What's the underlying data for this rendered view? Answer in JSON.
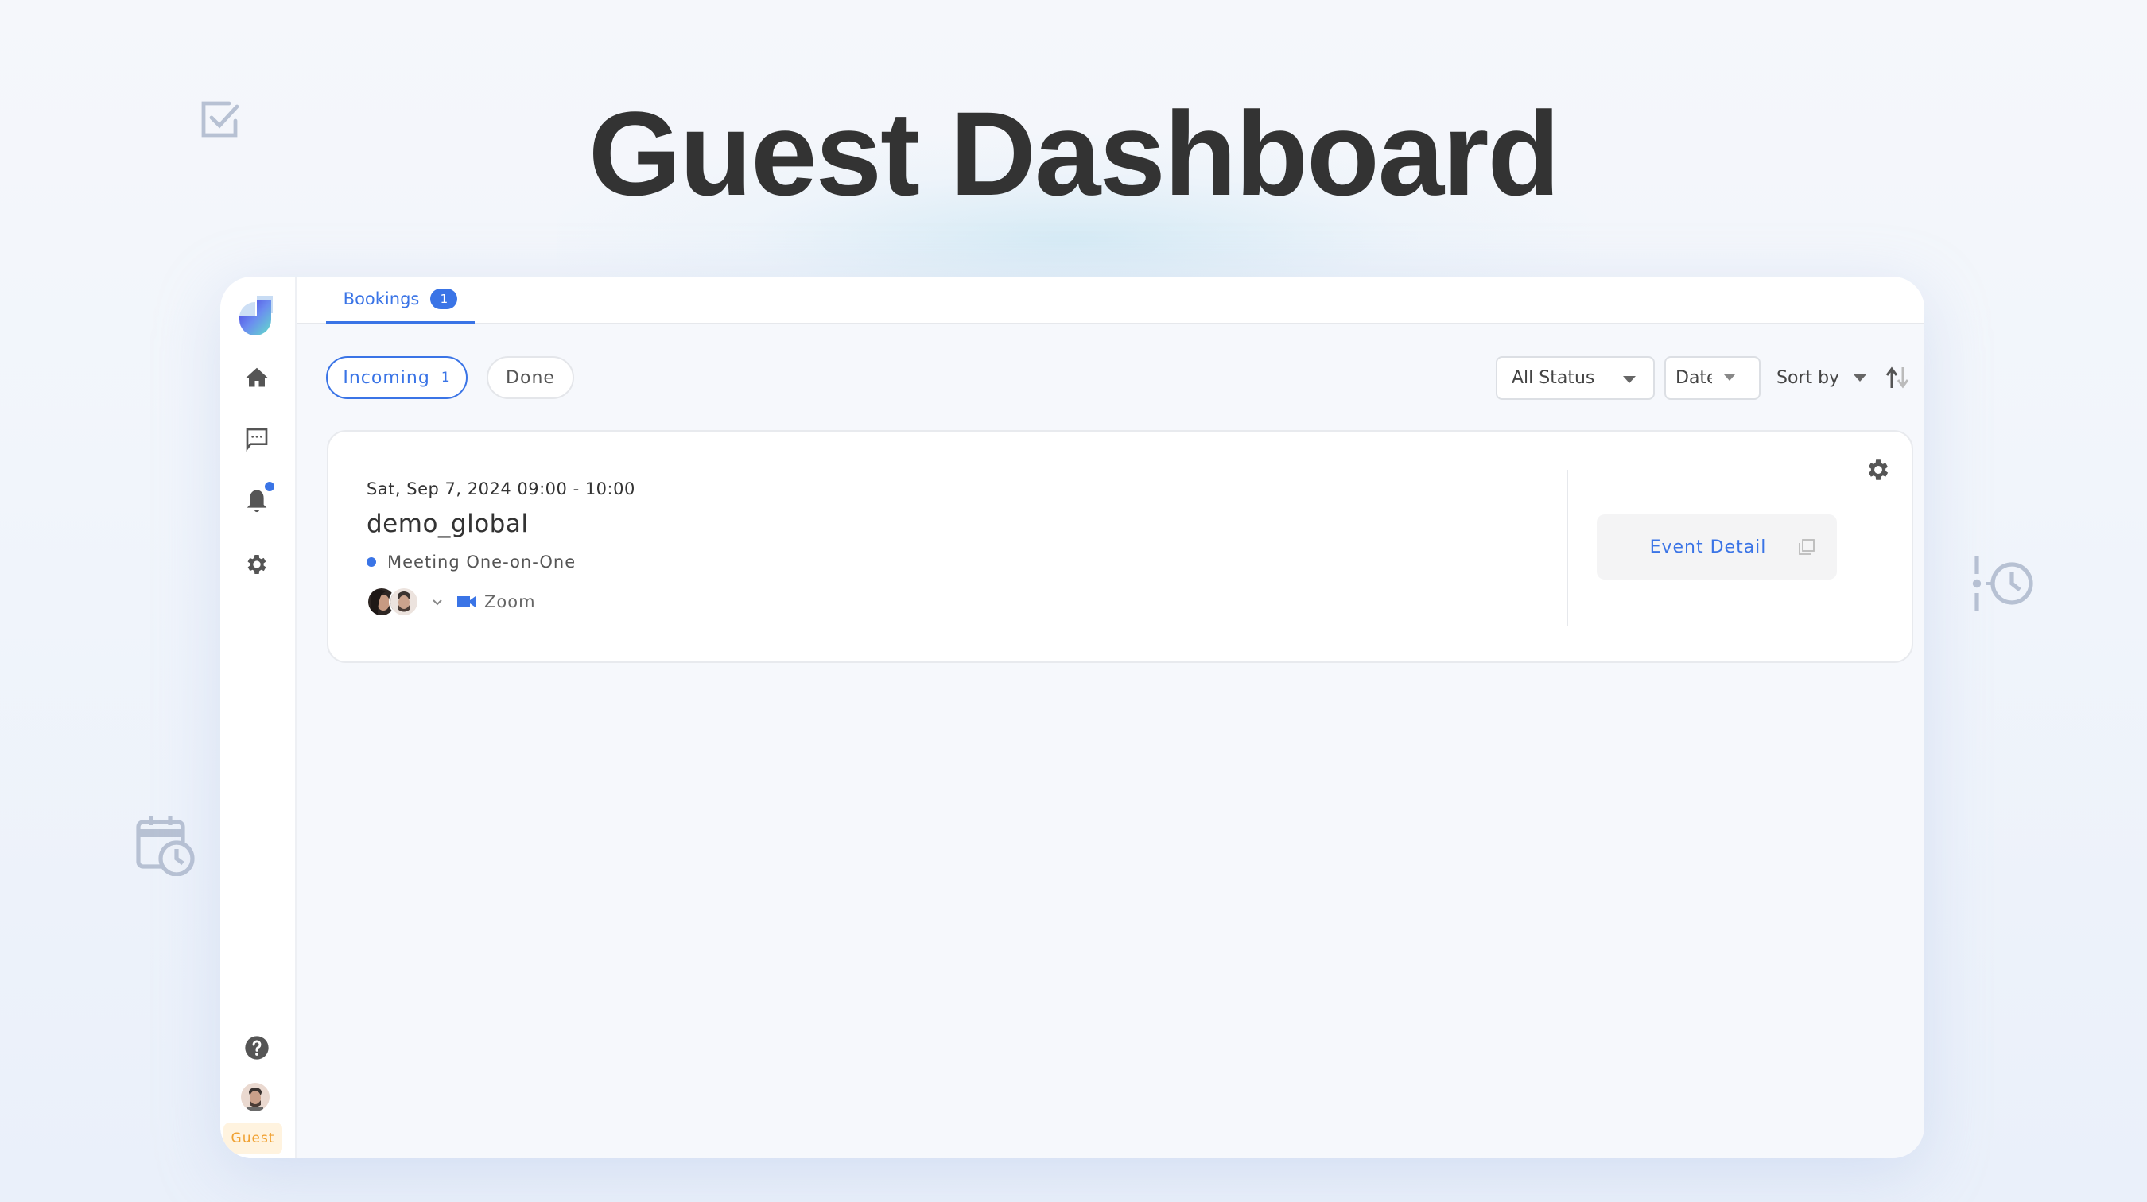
{
  "page": {
    "title": "Guest Dashboard"
  },
  "sidebar": {
    "items": [
      {
        "name": "home",
        "icon": "home-icon"
      },
      {
        "name": "messages",
        "icon": "chat-icon"
      },
      {
        "name": "notifications",
        "icon": "bell-icon",
        "has_unread": true
      },
      {
        "name": "settings",
        "icon": "gear-icon"
      }
    ],
    "help_icon": "help-icon",
    "role_badge": "Guest"
  },
  "tabs": [
    {
      "label": "Bookings",
      "count": "1",
      "active": true
    }
  ],
  "filters": {
    "pills": [
      {
        "label": "Incoming",
        "count": "1",
        "active": true
      },
      {
        "label": "Done",
        "active": false
      }
    ],
    "status_select": "All Status",
    "date_select": "Date",
    "sort_label": "Sort by"
  },
  "bookings": [
    {
      "datetime": "Sat, Sep 7, 2024 09:00 - 10:00",
      "title": "demo_global",
      "type": "Meeting One-on-One",
      "location": "Zoom",
      "action_label": "Event Detail"
    }
  ],
  "colors": {
    "accent": "#3a74e6",
    "guest_badge_bg": "#fff3df",
    "guest_badge_text": "#f0a030",
    "title_text": "#333333"
  }
}
